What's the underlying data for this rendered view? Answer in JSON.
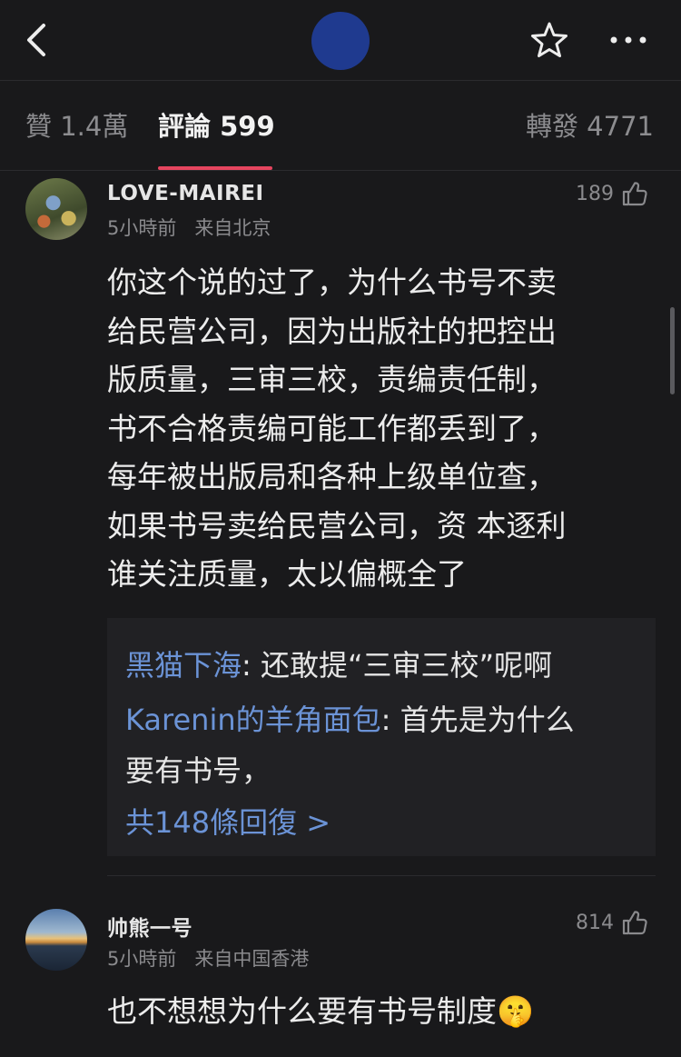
{
  "header": {
    "back_icon": "chevron-left-icon",
    "favorite_icon": "star-outline-icon",
    "more_icon": "more-dots-icon",
    "avatar_color": "#1f3a8f"
  },
  "tabs": {
    "likes": "贊 1.4萬",
    "comments": "評論 599",
    "reposts": "轉發 4771",
    "active_color": "#e5455f"
  },
  "comments": [
    {
      "username": "LOVE-MAIREI",
      "time": "5小時前",
      "location": "来自北京",
      "likes": "189",
      "lines": [
        "你这个说的过了，为什么书号不卖",
        "给民营公司，因为出版社的把控出",
        "版质量，三审三校，责编责任制，",
        "书不合格责编可能工作都丢到了，",
        "每年被出版局和各种上级单位查，",
        "如果书号卖给民营公司，资 本逐利",
        "谁关注质量，太以偏概全了"
      ],
      "replies": [
        {
          "name": "黑猫下海",
          "text": ": 还敢提“三审三校”呢啊"
        },
        {
          "name": "Karenin的羊角面包",
          "text": ": 首先是为什么",
          "text2": "要有书号，"
        }
      ],
      "more_replies": "共148條回復 >"
    },
    {
      "username": "帅熊一号",
      "time": "5小時前",
      "location": "来自中国香港",
      "likes": "814",
      "text": "也不想想为什么要有书号制度",
      "emoji": "🤫"
    }
  ]
}
